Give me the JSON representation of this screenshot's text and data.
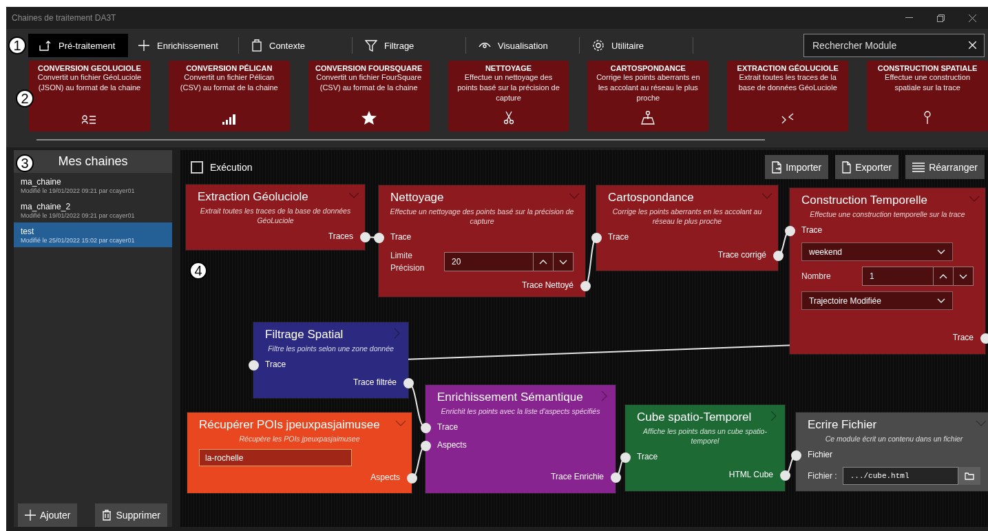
{
  "window": {
    "title": "Chaines de traitement DA3T"
  },
  "callouts": [
    "1",
    "2",
    "3",
    "4"
  ],
  "tabs": [
    {
      "label": "Pré-traitement",
      "selected": true
    },
    {
      "label": "Enrichissement",
      "selected": false
    },
    {
      "label": "Contexte",
      "selected": false
    },
    {
      "label": "Filtrage",
      "selected": false
    },
    {
      "label": "Visualisation",
      "selected": false
    },
    {
      "label": "Utilitaire",
      "selected": false
    }
  ],
  "search": {
    "placeholder": "Rechercher Module"
  },
  "modules": [
    {
      "title": "CONVERSION GEOLUCIOLE",
      "description": "Convertit un fichier GéoLuciole (JSON) au format de la chaine"
    },
    {
      "title": "CONVERSION PÉLICAN",
      "description": "Convertit un fichier Pélican (CSV) au format de la chaine"
    },
    {
      "title": "CONVERSION FOURSQUARE",
      "description": "Convertit un fichier FourSquare (CSV) au format de la chaine"
    },
    {
      "title": "NETTOYAGE",
      "description": "Effectue un nettoyage des points basé sur la précision de capture"
    },
    {
      "title": "CARTOSPONDANCE",
      "description": "Corrige les points aberrants en les accolant au réseau le plus proche"
    },
    {
      "title": "EXTRACTION GÉOLUCIOLE",
      "description": "Extrait toutes les traces de la base de données GéoLuciole"
    },
    {
      "title": "CONSTRUCTION SPATIALE",
      "description": "Effectue une construction spatiale sur la trace"
    }
  ],
  "sidebar": {
    "title": "Mes chaines",
    "items": [
      {
        "name": "ma_chaine",
        "meta": "Modifié le 19/01/2022 09:21 par ccayer01",
        "selected": false
      },
      {
        "name": "ma_chaine_2",
        "meta": "Modifié le 19/01/2022 09:21 par ccayer01",
        "selected": false
      },
      {
        "name": "test",
        "meta": "Modifié le 25/01/2022 15:02 par ccayer01",
        "selected": true
      }
    ],
    "buttons": [
      "Ajouter",
      "Supprimer"
    ]
  },
  "canvas": {
    "execution": {
      "label": "Exécution",
      "checked": false
    },
    "buttons": [
      "Importer",
      "Exporter",
      "Réarranger"
    ],
    "nodes": [
      {
        "title": "Extraction Géoluciole",
        "description": "Extrait toutes les traces de la base de données GéoLuciole",
        "color": "#8c1a1e",
        "expanded": true,
        "rows": [
          {
            "kind": "output",
            "label": "Traces"
          }
        ]
      },
      {
        "title": "Nettoyage",
        "description": "Effectue un nettoyage des points basé sur la précision de capture",
        "color": "#8c1a1e",
        "expanded": true,
        "rows": [
          {
            "kind": "input",
            "label": "Trace"
          },
          {
            "kind": "spinner",
            "label": "Limite Précision",
            "value": "20"
          },
          {
            "kind": "output",
            "label": "Trace Nettoyé"
          }
        ]
      },
      {
        "title": "Cartospondance",
        "description": "Corrige les points aberrants en les accolant au réseau le plus proche",
        "color": "#8c1a1e",
        "expanded": true,
        "rows": [
          {
            "kind": "input",
            "label": "Trace"
          },
          {
            "kind": "output",
            "label": "Trace corrigé"
          }
        ]
      },
      {
        "title": "Construction Temporelle",
        "description": "Effectue une construction temporelle sur la trace",
        "color": "#8c1a1e",
        "expanded": true,
        "rows": [
          {
            "kind": "input",
            "label": "Trace"
          },
          {
            "kind": "dropdown",
            "value": "weekend"
          },
          {
            "kind": "spinner",
            "label": "Nombre",
            "value": "1"
          },
          {
            "kind": "dropdown",
            "value": "Trajectoire Modifiée"
          },
          {
            "kind": "output",
            "label": "Trace"
          }
        ]
      },
      {
        "title": "Filtrage Spatial",
        "description": "Filtre les points selon une zone donnée",
        "color": "#2b2a80",
        "expanded": false,
        "rows": [
          {
            "kind": "input",
            "label": "Trace"
          },
          {
            "kind": "output",
            "label": "Trace filtrée"
          }
        ]
      },
      {
        "title": "Récupérer POIs jpeuxpasjaimusee",
        "description": "Récupère les POIs jpeuxpasjaimusee",
        "color": "#e8471f",
        "expanded": true,
        "rows": [
          {
            "kind": "textfield",
            "value": "la-rochelle"
          },
          {
            "kind": "output",
            "label": "Aspects"
          }
        ]
      },
      {
        "title": "Enrichissement Sémantique",
        "description": "Enrichit les points avec la liste d'aspects spécifiés",
        "color": "#88248f",
        "expanded": false,
        "rows": [
          {
            "kind": "input",
            "label": "Trace"
          },
          {
            "kind": "input",
            "label": "Aspects"
          },
          {
            "kind": "output",
            "label": "Trace Enrichie"
          }
        ]
      },
      {
        "title": "Cube spatio-Temporel",
        "description": "Affiche les points dans un cube spatio-temporel",
        "color": "#1d6a35",
        "expanded": false,
        "rows": [
          {
            "kind": "input",
            "label": "Trace"
          },
          {
            "kind": "output",
            "label": "HTML Cube"
          }
        ]
      },
      {
        "title": "Ecrire Fichier",
        "description": "Ce module écrit un contenu dans un fichier",
        "color": "#4b4b4b",
        "expanded": true,
        "rows": [
          {
            "kind": "input",
            "label": "Fichier"
          },
          {
            "kind": "file",
            "label": "Fichier :",
            "value": ".../cube.html"
          }
        ]
      }
    ]
  }
}
